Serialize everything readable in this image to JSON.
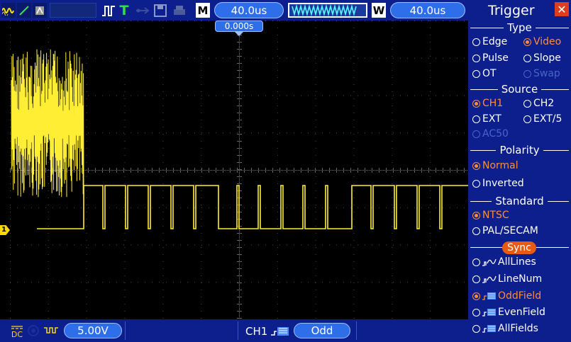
{
  "toolbar": {
    "mode_label": "M",
    "timebase": "40.0us",
    "window_label": "W",
    "window_timebase": "40.0us",
    "trigger_status": "T"
  },
  "screen": {
    "time_position": "0.000s",
    "channel_marker": "1"
  },
  "bottom": {
    "coupling": "DC",
    "ch1_scale": "5.00V",
    "trigger_source": "CH1",
    "trigger_field": "Odd"
  },
  "panel": {
    "title": "Trigger",
    "close_label": "✕",
    "sections": {
      "type": "Type",
      "source": "Source",
      "polarity": "Polarity",
      "standard": "Standard",
      "sync": "Sync"
    },
    "type_options": [
      "Edge",
      "Video",
      "Pulse",
      "Slope",
      "OT",
      "Swap"
    ],
    "source_options": [
      "CH1",
      "CH2",
      "EXT",
      "EXT/5",
      "AC50"
    ],
    "polarity_options": [
      "Normal",
      "Inverted"
    ],
    "standard_options": [
      "NTSC",
      "PAL/SECAM"
    ],
    "sync_options": [
      "AllLines",
      "LineNum",
      "OddField",
      "EvenField",
      "AllFields"
    ]
  },
  "colors": {
    "panel_bg": "#0c1f8c",
    "accent_blue": "#2e6ee8",
    "selected": "#ff8c3a",
    "trace": "#ffee33",
    "channel1": "#ffd800"
  }
}
